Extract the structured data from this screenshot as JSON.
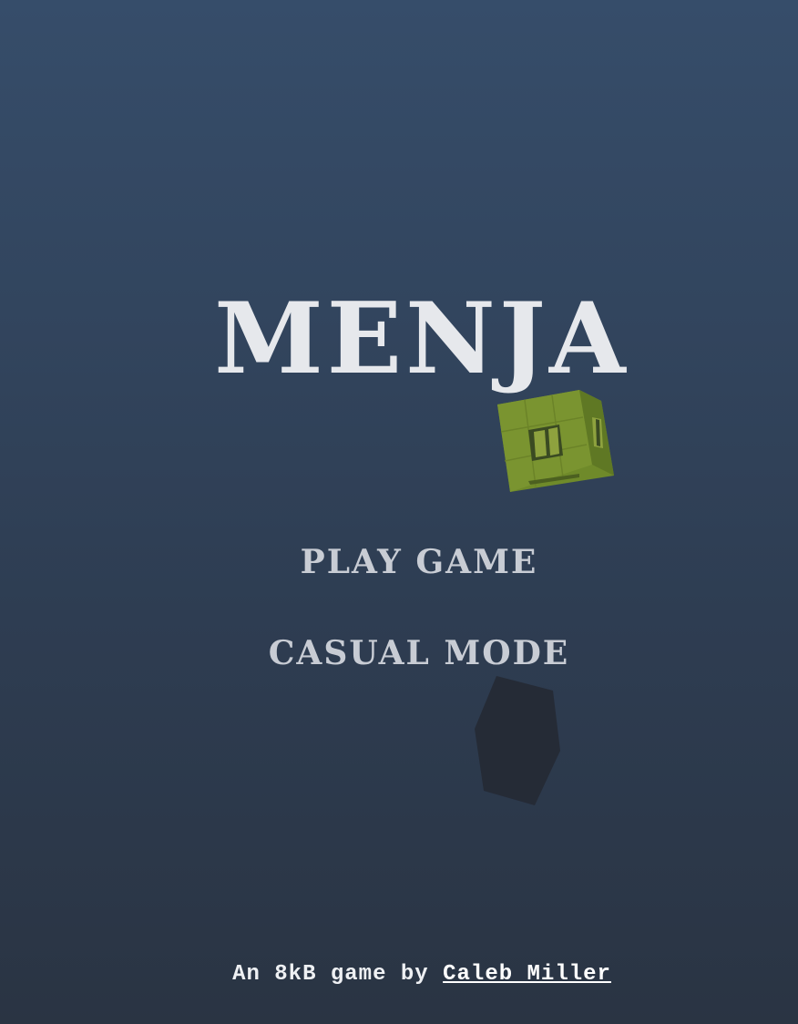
{
  "title": "MENJA",
  "menu": {
    "play_label": "PLAY GAME",
    "casual_label": "CASUAL MODE"
  },
  "credits": {
    "prefix": "An 8kB game by ",
    "author": "Caleb Miller"
  },
  "colors": {
    "background_top": "#364d6a",
    "background_bottom": "#2a3443",
    "title": "#e6e8ec",
    "menu_text": "#c8ccd4",
    "cube_green": "#7a9430",
    "shard_dark": "#252b36"
  }
}
